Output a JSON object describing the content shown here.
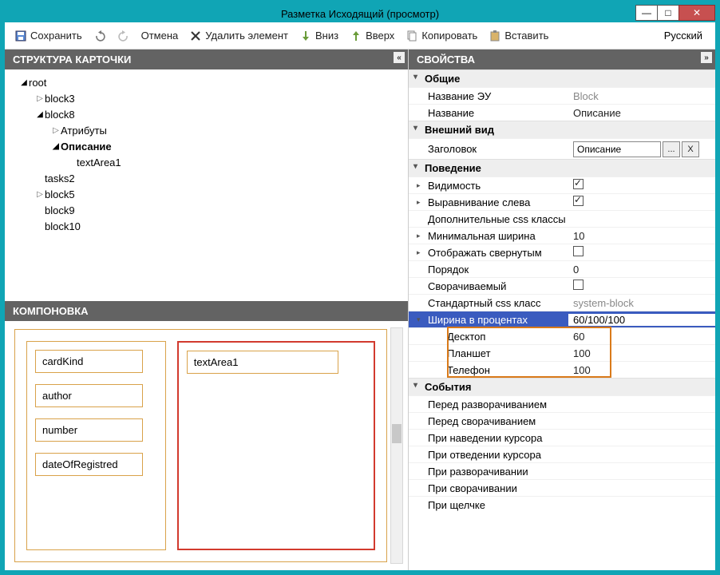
{
  "window": {
    "title": "Разметка Исходящий (просмотр)"
  },
  "toolbar": {
    "save": "Сохранить",
    "cancel": "Отмена",
    "delete": "Удалить элемент",
    "down": "Вниз",
    "up": "Вверх",
    "copy": "Копировать",
    "paste": "Вставить",
    "lang": "Русский"
  },
  "panels": {
    "structure": "СТРУКТУРА КАРТОЧКИ",
    "layout": "КОМПОНОВКА",
    "props": "СВОЙСТВА"
  },
  "tree": {
    "root": "root",
    "block3": "block3",
    "block8": "block8",
    "attrs": "Атрибуты",
    "desc": "Описание",
    "textArea1": "textArea1",
    "tasks2": "tasks2",
    "block5": "block5",
    "block9": "block9",
    "block10": "block10"
  },
  "canvas": {
    "cardKind": "cardKind",
    "author": "author",
    "number": "number",
    "dateOfRegistred": "dateOfRegistred",
    "textArea1": "textArea1"
  },
  "props": {
    "groups": {
      "general": "Общие",
      "appearance": "Внешний вид",
      "behavior": "Поведение",
      "events": "События"
    },
    "rows": {
      "controlName": {
        "label": "Название ЭУ",
        "value": "Block"
      },
      "name": {
        "label": "Название",
        "value": "Описание"
      },
      "header": {
        "label": "Заголовок",
        "value": "Описание"
      },
      "visibility": {
        "label": "Видимость",
        "checked": true
      },
      "alignLeft": {
        "label": "Выравнивание слева",
        "checked": true
      },
      "cssExtra": {
        "label": "Дополнительные css классы",
        "value": ""
      },
      "minWidth": {
        "label": "Минимальная ширина",
        "value": "10"
      },
      "collapsed": {
        "label": "Отображать свернутым",
        "checked": false
      },
      "order": {
        "label": "Порядок",
        "value": "0"
      },
      "collapsible": {
        "label": "Сворачиваемый",
        "checked": false
      },
      "stdCss": {
        "label": "Стандартный css класс",
        "value": "system-block"
      },
      "widthPct": {
        "label": "Ширина в процентах",
        "value": "60/100/100"
      },
      "desktop": {
        "label": "Десктоп",
        "value": "60"
      },
      "tablet": {
        "label": "Планшет",
        "value": "100"
      },
      "phone": {
        "label": "Телефон",
        "value": "100"
      },
      "beforeExpand": "Перед разворачиванием",
      "beforeCollapse": "Перед сворачиванием",
      "onHover": "При наведении курсора",
      "onLeave": "При отведении курсора",
      "onExpand": "При разворачивании",
      "onCollapse": "При сворачивании",
      "onClick": "При щелчке"
    }
  }
}
